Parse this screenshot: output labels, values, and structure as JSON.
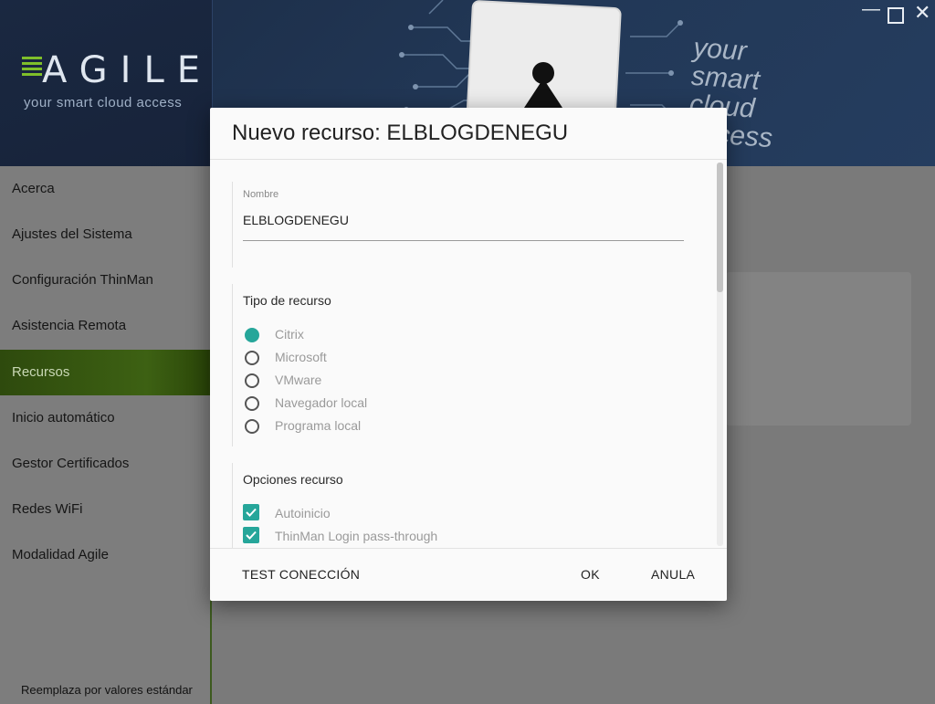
{
  "header": {
    "logo_text": "AGILE",
    "logo_tagline": "your smart cloud access",
    "slogan_lines": [
      "your",
      "smart",
      "cloud",
      "access"
    ],
    "window_controls": {
      "minimize": "—",
      "close": "✕"
    }
  },
  "sidebar": {
    "items": [
      {
        "label": "Acerca"
      },
      {
        "label": "Ajustes del Sistema"
      },
      {
        "label": "Configuración ThinMan"
      },
      {
        "label": "Asistencia Remota"
      },
      {
        "label": "Recursos",
        "active": true
      },
      {
        "label": "Inicio automático"
      },
      {
        "label": "Gestor Certificados"
      },
      {
        "label": "Redes WiFi"
      },
      {
        "label": "Modalidad Agile"
      }
    ],
    "reset_label": "Reemplaza por valores estándar"
  },
  "dialog": {
    "title": "Nuevo recurso: ELBLOGDENEGU",
    "name_field": {
      "label": "Nombre",
      "value": "ELBLOGDENEGU"
    },
    "resource_type": {
      "title": "Tipo de recurso",
      "selected": "Citrix",
      "options": [
        "Citrix",
        "Microsoft",
        "VMware",
        "Navegador local",
        "Programa local"
      ]
    },
    "resource_options": {
      "title": "Opciones recurso",
      "options": [
        {
          "label": "Autoinicio",
          "checked": true
        },
        {
          "label": "ThinMan Login pass-through",
          "checked": true
        }
      ]
    },
    "buttons": {
      "test": "TEST CONECCIÓN",
      "ok": "OK",
      "cancel": "ANULA"
    }
  },
  "colors": {
    "accent": "#26a69a",
    "active_nav": "#3d6113"
  }
}
